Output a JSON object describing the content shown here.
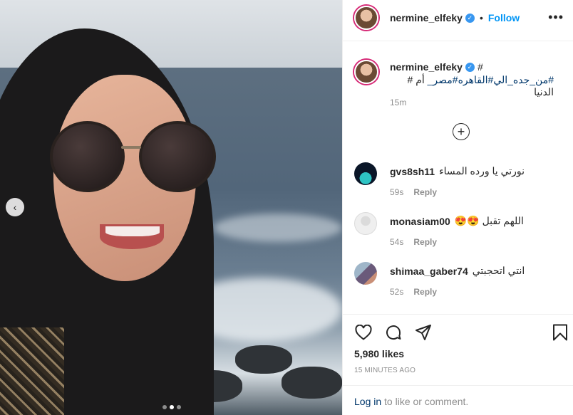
{
  "post": {
    "username": "nermine_elfeky",
    "follow_label": "Follow",
    "separator": "•",
    "more_glyph": "•••",
    "caption": {
      "tag_after_name": "#",
      "text_parts": [
        "#من_جده_الي",
        "#القاهره",
        "#مصر_",
        " أم # الدنيا"
      ]
    },
    "time_ago_short": "15m",
    "load_more_glyph": "+",
    "likes": "5,980 likes",
    "posted_time": "15 MINUTES AGO"
  },
  "comments": [
    {
      "username": "gvs8sh11",
      "text": "نورتي يا ورده المساء",
      "time": "59s",
      "reply_label": "Reply"
    },
    {
      "username": "monasiam00",
      "text": "اللهم تقبل 😍😍",
      "time": "54s",
      "reply_label": "Reply"
    },
    {
      "username": "shimaa_gaber74",
      "text": "انتي اتحجبتي",
      "time": "52s",
      "reply_label": "Reply"
    }
  ],
  "login_bar": {
    "login_label": "Log in",
    "rest_text": " to like or comment."
  },
  "carousel": {
    "prev_glyph": "‹",
    "dot_count": 3,
    "active_dot": 2
  },
  "icons": {
    "like": "heart-icon",
    "comment": "comment-icon",
    "share": "share-icon",
    "save": "bookmark-icon",
    "verified": "verified-badge-icon",
    "prev": "chevron-left-icon"
  },
  "colors": {
    "link_blue": "#0095f6",
    "verified_blue": "#3897f0",
    "hashtag": "#00376b",
    "meta_grey": "#8e8e8e",
    "story_ring": "#d62976"
  }
}
